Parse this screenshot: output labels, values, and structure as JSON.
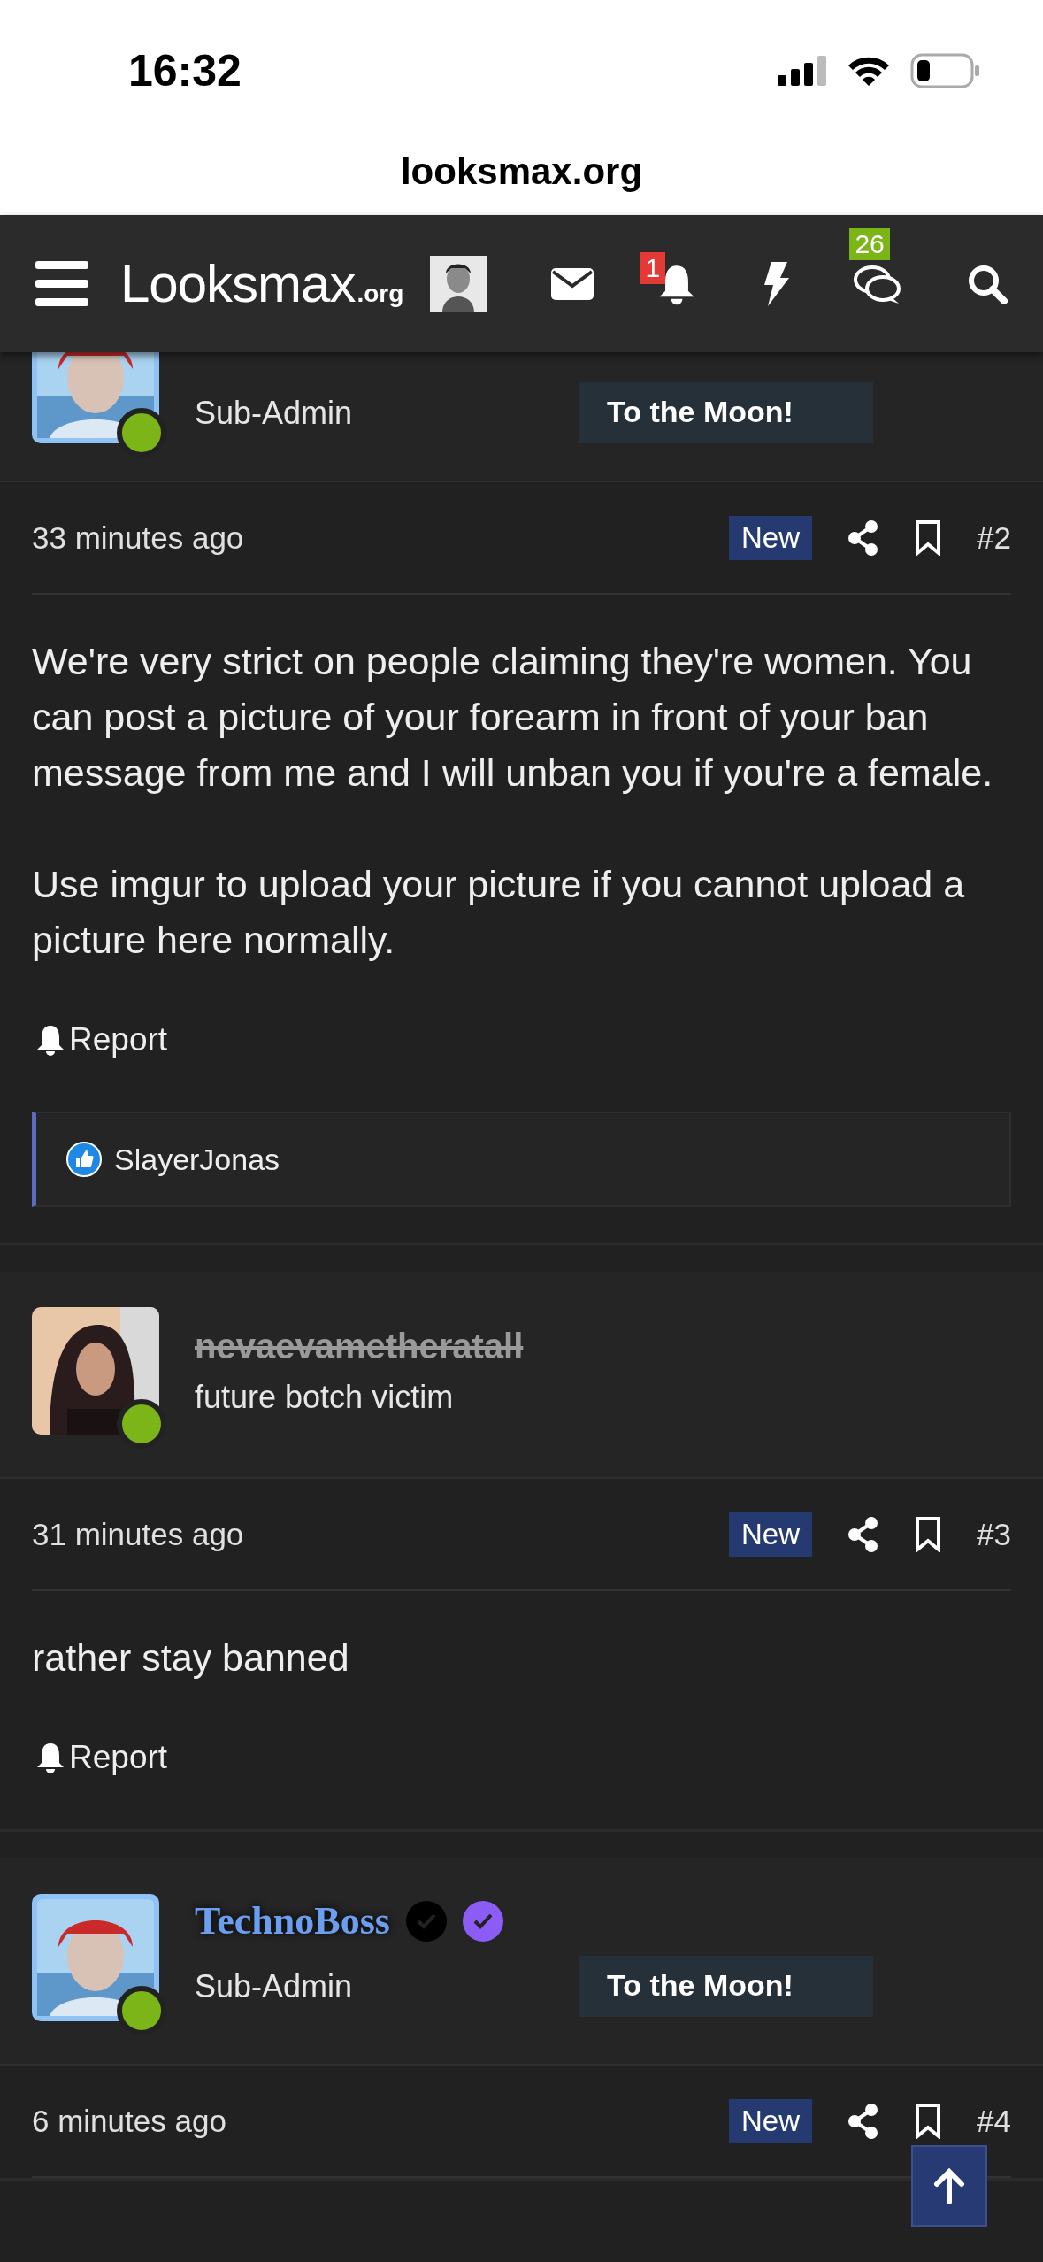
{
  "status_bar": {
    "time": "16:32"
  },
  "url_bar": {
    "url": "looksmax.org"
  },
  "nav": {
    "logo": "Looksmax",
    "logo_suffix": ".org",
    "alerts_badge": "1",
    "conversations_badge": "26"
  },
  "posts": [
    {
      "user": {
        "title": "Sub-Admin",
        "banner": "To the Moon!",
        "online": true
      },
      "time": "33 minutes ago",
      "new_label": "New",
      "number": "#2",
      "body": [
        "We're very strict on people claiming they're women. You can post a picture of your forearm in front of your ban message from me and I will unban you if you're a female.",
        "Use imgur to upload your picture if you cannot upload a picture here normally."
      ],
      "report": "Report",
      "reactions": "SlayerJonas"
    },
    {
      "user": {
        "name": "nevaevametheratall",
        "struck": true,
        "title": "future botch victim",
        "online": true
      },
      "time": "31 minutes ago",
      "new_label": "New",
      "number": "#3",
      "body": [
        "rather stay banned"
      ],
      "report": "Report"
    },
    {
      "user": {
        "name": "TechnoBoss",
        "struck": false,
        "badges": [
          {
            "color": "#000000"
          },
          {
            "color": "#8b5cf6"
          }
        ],
        "title": "Sub-Admin",
        "banner": "To the Moon!",
        "online": true
      },
      "time": "6 minutes ago",
      "new_label": "New",
      "number": "#4"
    }
  ]
}
